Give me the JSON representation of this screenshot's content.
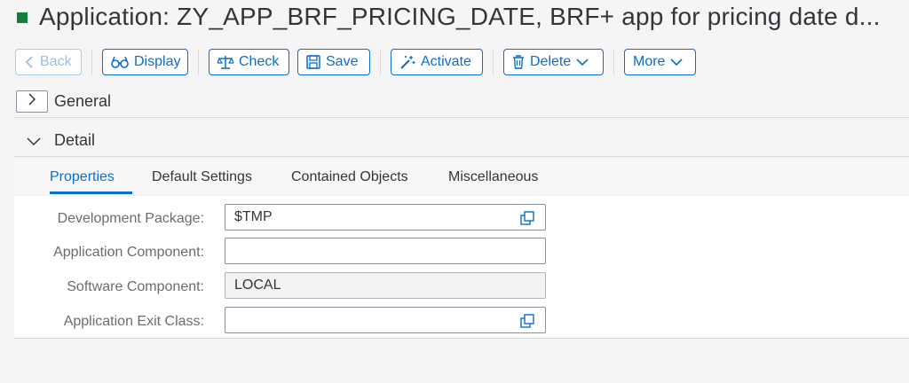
{
  "title": "Application: ZY_APP_BRF_PRICING_DATE, BRF+ app for pricing date d...",
  "toolbar": {
    "back": "Back",
    "display": "Display",
    "check": "Check",
    "save": "Save",
    "activate": "Activate",
    "delete": "Delete",
    "more": "More"
  },
  "sections": {
    "general": "General",
    "detail": "Detail"
  },
  "tabs": [
    "Properties",
    "Default Settings",
    "Contained Objects",
    "Miscellaneous"
  ],
  "form": {
    "development_package": {
      "label": "Development Package:",
      "value": "$TMP"
    },
    "application_component": {
      "label": "Application Component:",
      "value": ""
    },
    "software_component": {
      "label": "Software Component:",
      "value": "LOCAL"
    },
    "application_exit_class": {
      "label": "Application Exit Class:",
      "value": ""
    }
  },
  "colors": {
    "accent": "#0a6ed1",
    "status": "#107e3e"
  }
}
